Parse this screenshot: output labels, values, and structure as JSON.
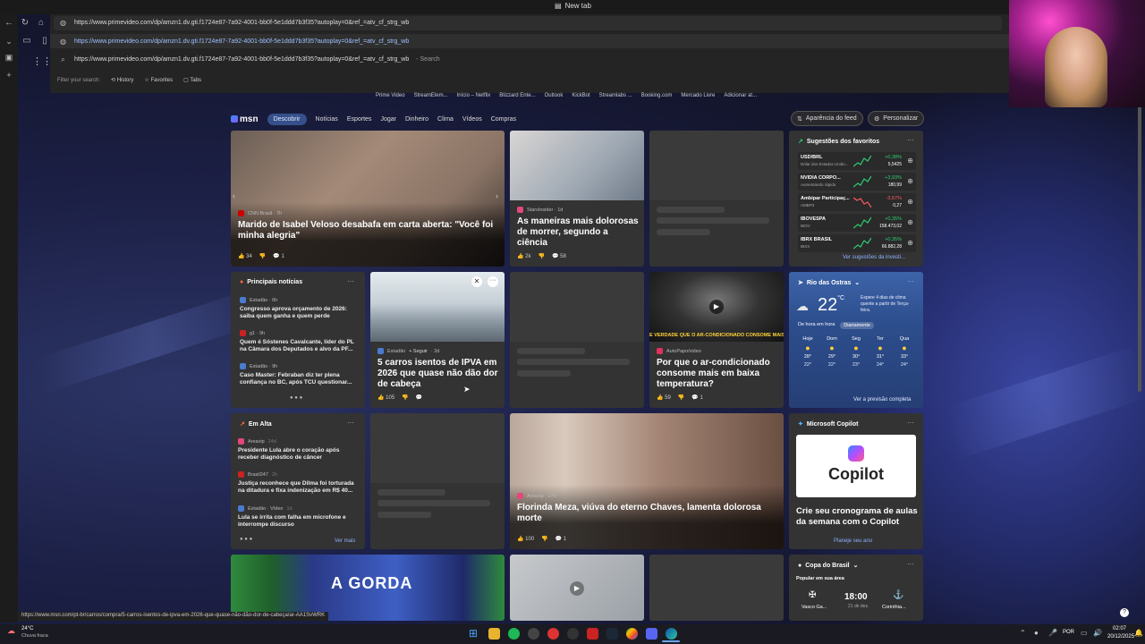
{
  "browser": {
    "tab_title": "New tab",
    "address_value": "https://www.primevideo.com/dp/amzn1.dv.gti.f1724e87-7a92-4001-bb0f-5e1ddd7b3f35?autoplay=0&ref_=atv_cf_strg_wb",
    "suggestions": [
      {
        "url": "https://www.primevideo.com/dp/amzn1.dv.gti.f1724e87-7a92-4001-bb0f-5e1ddd7b3f35?autoplay=0&ref_=atv_cf_strg_wb",
        "suffix": ""
      },
      {
        "url": "https://www.primevideo.com/dp/amzn1.dv.gti.f1724e87-7a92-4001-bb0f-5e1ddd7b3f35?autoplay=0&ref_=atv_cf_strg_wb",
        "suffix": "- Search"
      }
    ],
    "filter_label": "Filter your search:",
    "filters": [
      "History",
      "Favorites",
      "Tabs"
    ],
    "favorites": [
      "Prime Video",
      "StreamElem...",
      "Início – Netflix",
      "Blizzard Ente...",
      "Outlook",
      "KickBot",
      "Streamlabs ...",
      "Booking.com",
      "Mercado Livre",
      "Adicionar at..."
    ],
    "status_url": "https://www.msn.com/pt-br/carros/compra/5-carros-isentos-de-ipva-em-2026-que-quase-não-dão-dor-de-cabeça/ar-AA1SvWRK"
  },
  "msn": {
    "logo": "msn",
    "nav": [
      "Descobrir",
      "Notícias",
      "Esportes",
      "Jogar",
      "Dinheiro",
      "Clima",
      "Vídeos",
      "Compras"
    ],
    "feed_button": "Aparência do feed",
    "customize_button": "Personalizar",
    "hero": {
      "source": "CNN Brasil · 7h",
      "title": "Marido de Isabel Veloso desabafa em carta aberta: \"Você foi minha alegria\"",
      "likes": "34",
      "comments": "1"
    },
    "card2": {
      "source": "StarsInsider · 1d",
      "title": "As maneiras mais dolorosas de morrer, segundo a ciência",
      "likes": "2k",
      "comments": "58"
    },
    "favorites_panel": {
      "title": "Sugestões dos favoritos",
      "rows": [
        {
          "name": "USD/BRL",
          "sub": "Dólar dos Estados Unido...",
          "change": "+0,38%",
          "value": "5,5425",
          "up": true
        },
        {
          "name": "NVIDIA CORPO...",
          "sub": "Aumentando rápido",
          "change": "+3,93%",
          "value": "180,99",
          "up": true
        },
        {
          "name": "Ambipar Participaç...",
          "sub": "AMBP3",
          "change": "-3,57%",
          "value": "0,27",
          "up": false
        },
        {
          "name": "IBOVESPA",
          "sub": "IBOV",
          "change": "+0,35%",
          "value": "158.473,02",
          "up": true
        },
        {
          "name": "IBRX BRASIL",
          "sub": "IBXX",
          "change": "+0,35%",
          "value": "66.882,28",
          "up": true
        }
      ],
      "link": "Ver sugestões da investi..."
    },
    "top_news": {
      "title": "Principais notícias",
      "items": [
        {
          "source": "Estadão · 6h",
          "title": "Congresso aprova orçamento de 2026: saiba quem ganha e quem perde"
        },
        {
          "source": "g1 · 9h",
          "title": "Quem é Sóstenes Cavalcante, líder do PL na Câmara dos Deputados e alvo da PF..."
        },
        {
          "source": "Estadão · 9h",
          "title": "Caso Master: Febraban diz ter plena confiança no BC, após TCU questionar..."
        }
      ]
    },
    "ipva": {
      "source": "Estadão",
      "follow": "+ Seguir",
      "age": "· 2d",
      "title": "5 carros isentos de IPVA em 2026 que quase não dão dor de cabeça",
      "likes": "105"
    },
    "ac": {
      "source": "AutoPapo/video",
      "overlay": "É VERDADE QUE O AR-CONDICIONADO CONSOME MAIS EM BAIXA",
      "title": "Por que o ar-condicionado consome mais em baixa temperatura?",
      "likes": "59",
      "comments": "1"
    },
    "weather": {
      "city": "Rio das Ostras",
      "temp": "22",
      "unit": "°C",
      "note": "Espere 4 dias de clima quente a partir de Terça-feira.",
      "tabs": [
        "De hora em hora",
        "Diariamente"
      ],
      "days": [
        {
          "d": "Hoje",
          "hi": "28°",
          "lo": "22°"
        },
        {
          "d": "Dom",
          "hi": "29°",
          "lo": "22°"
        },
        {
          "d": "Seg",
          "hi": "30°",
          "lo": "23°"
        },
        {
          "d": "Ter",
          "hi": "31°",
          "lo": "24°"
        },
        {
          "d": "Qua",
          "hi": "33°",
          "lo": "24°"
        }
      ],
      "link": "Ver a previsão completa"
    },
    "trending": {
      "title": "Em Alta",
      "items": [
        {
          "source": "Areavip",
          "age": "24d",
          "title": "Presidente Lula abre o coração após receber diagnóstico de câncer"
        },
        {
          "source": "Brasil247",
          "age": "2h",
          "title": "Justiça reconhece que Dilma foi torturada na ditadura e fixa indenização em R$ 40..."
        },
        {
          "source": "Estadão · Vídeo",
          "age": "1d",
          "title": "Lula se irrita com falha em microfone e interrompe discurso"
        }
      ],
      "link": "Ver mais"
    },
    "florinda": {
      "source": "Areavip · 17h",
      "title": "Florinda Meza, viúva do eterno Chaves, lamenta dolorosa morte",
      "likes": "100",
      "comments": "1"
    },
    "copilot": {
      "title": "Microsoft Copilot",
      "logo": "Copilot",
      "headline": "Crie seu cronograma de aulas da semana com o Copilot",
      "link": "Planeje seu ano"
    },
    "bottom_banner": "A GORDA",
    "cup": {
      "title": "Copa do Brasil",
      "sub": "Popular em sua área",
      "home": "Vasco Ga...",
      "away": "Corinthia...",
      "time": "18:00",
      "date": "21 de dez."
    }
  },
  "system": {
    "weather_temp": "24°C",
    "weather_text": "Chuva fraca",
    "lang": "POR",
    "clock": "02:07",
    "date": "20/12/2025"
  }
}
